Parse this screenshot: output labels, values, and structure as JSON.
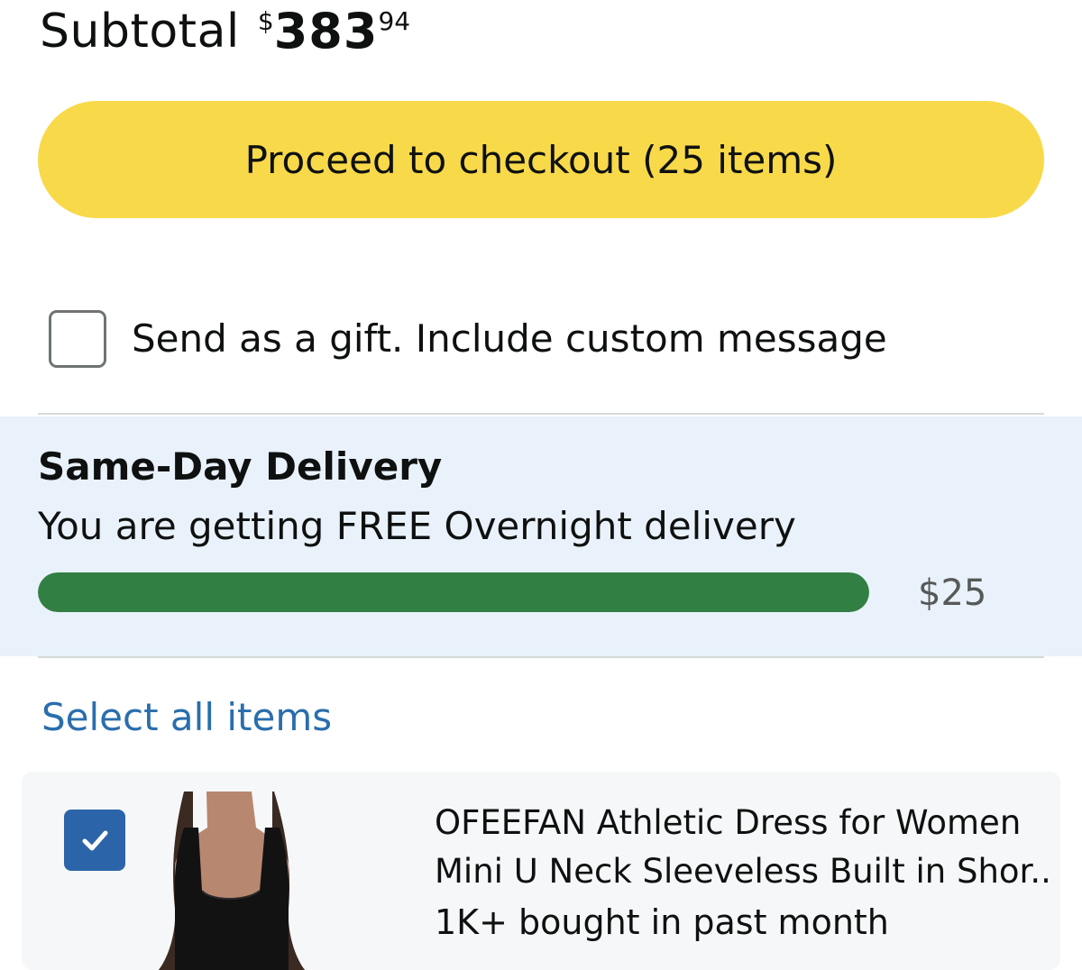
{
  "subtotal": {
    "label": "Subtotal",
    "currency_symbol": "$",
    "whole": "383",
    "fraction": "94"
  },
  "checkout": {
    "label": "Proceed to checkout (25 items)"
  },
  "gift": {
    "label": "Send as a gift. Include custom message",
    "checked": false
  },
  "delivery": {
    "title": "Same-Day Delivery",
    "subtitle": "You are getting FREE Overnight delivery",
    "progress_fraction": 1.0,
    "threshold": "$25",
    "fill_color": "#327f44",
    "background_color": "#e9f2fa"
  },
  "select_all": {
    "label": "Select all items",
    "color": "#2a6ead"
  },
  "cart_items": [
    {
      "checked": true,
      "title_line1": "OFEEFAN Athletic Dress for Women",
      "title_line2": "Mini U Neck Sleeveless Built in Shor...",
      "bought": "1K+ bought in past month"
    }
  ],
  "colors": {
    "checkout_button": "#f8d949",
    "checkbox_checked": "#2b64a8",
    "divider": "#d5d9d9"
  }
}
